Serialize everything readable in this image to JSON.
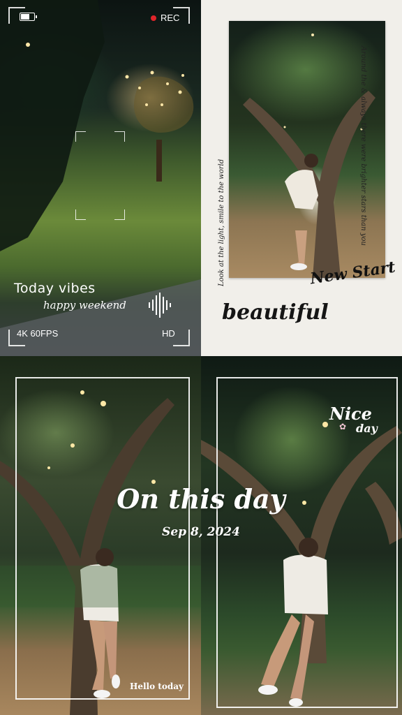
{
  "panel1": {
    "rec_label": "REC",
    "line1": "Today vibes",
    "line2": "happy weekend",
    "format": "4K 60FPS",
    "quality": "HD"
  },
  "panel2": {
    "script_top": "Around the & always there were brighter stars than you",
    "script_left": "Look at the light, smile to the world",
    "new_start": "New Start",
    "beautiful": "beautiful"
  },
  "panel3": {
    "title": "On this day",
    "date": "Sep 8, 2024",
    "caption": "Hello today"
  },
  "panel4": {
    "nice": "Nice",
    "day": "day"
  }
}
